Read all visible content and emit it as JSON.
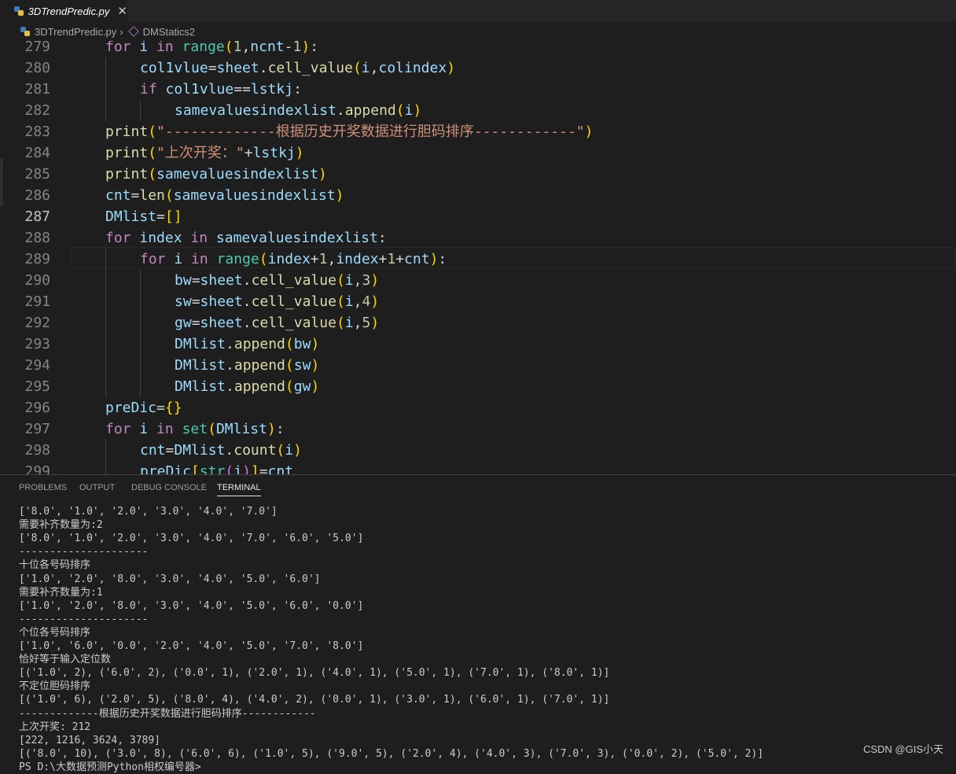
{
  "tab": {
    "title": "3DTrendPredic.py",
    "close": "✕"
  },
  "breadcrumb": {
    "file": "3DTrendPredic.py",
    "sep": "›",
    "symbol": "DMStatics2"
  },
  "editor": {
    "lines": [
      {
        "n": "279",
        "t": [
          [
            "kw",
            "for"
          ],
          [
            "op",
            " "
          ],
          [
            "var",
            "i"
          ],
          [
            "op",
            " "
          ],
          [
            "kw",
            "in"
          ],
          [
            "op",
            " "
          ],
          [
            "bi",
            "range"
          ],
          [
            "br1",
            "("
          ],
          [
            "num",
            "1"
          ],
          [
            "op",
            ","
          ],
          [
            "var",
            "ncnt"
          ],
          [
            "op",
            "-"
          ],
          [
            "num",
            "1"
          ],
          [
            "br1",
            ")"
          ],
          [
            "op",
            ":"
          ]
        ]
      },
      {
        "n": "280",
        "t": [
          [
            "var",
            "col1vlue"
          ],
          [
            "op",
            "="
          ],
          [
            "var",
            "sheet"
          ],
          [
            "op",
            "."
          ],
          [
            "fn",
            "cell_value"
          ],
          [
            "br1",
            "("
          ],
          [
            "var",
            "i"
          ],
          [
            "op",
            ","
          ],
          [
            "var",
            "colindex"
          ],
          [
            "br1",
            ")"
          ]
        ]
      },
      {
        "n": "281",
        "t": [
          [
            "kw",
            "if"
          ],
          [
            "op",
            " "
          ],
          [
            "var",
            "col1vlue"
          ],
          [
            "op",
            "=="
          ],
          [
            "var",
            "lstkj"
          ],
          [
            "op",
            ":"
          ]
        ]
      },
      {
        "n": "282",
        "t": [
          [
            "var",
            "samevaluesindexlist"
          ],
          [
            "op",
            "."
          ],
          [
            "fn",
            "append"
          ],
          [
            "br1",
            "("
          ],
          [
            "var",
            "i"
          ],
          [
            "br1",
            ")"
          ]
        ]
      },
      {
        "n": "283",
        "t": [
          [
            "fn",
            "print"
          ],
          [
            "br1",
            "("
          ],
          [
            "str",
            "\"-------------根据历史开奖数据进行胆码排序------------\""
          ],
          [
            "br1",
            ")"
          ]
        ]
      },
      {
        "n": "284",
        "t": [
          [
            "fn",
            "print"
          ],
          [
            "br1",
            "("
          ],
          [
            "str",
            "\"上次开奖：\""
          ],
          [
            "op",
            "+"
          ],
          [
            "var",
            "lstkj"
          ],
          [
            "br1",
            ")"
          ]
        ]
      },
      {
        "n": "285",
        "t": [
          [
            "fn",
            "print"
          ],
          [
            "br1",
            "("
          ],
          [
            "var",
            "samevaluesindexlist"
          ],
          [
            "br1",
            ")"
          ]
        ]
      },
      {
        "n": "286",
        "t": [
          [
            "var",
            "cnt"
          ],
          [
            "op",
            "="
          ],
          [
            "fn",
            "len"
          ],
          [
            "br1",
            "("
          ],
          [
            "var",
            "samevaluesindexlist"
          ],
          [
            "br1",
            ")"
          ]
        ]
      },
      {
        "n": "287",
        "t": [
          [
            "var",
            "DMlist"
          ],
          [
            "op",
            "="
          ],
          [
            "br1",
            "[]"
          ]
        ]
      },
      {
        "n": "288",
        "t": [
          [
            "kw",
            "for"
          ],
          [
            "op",
            " "
          ],
          [
            "var",
            "index"
          ],
          [
            "op",
            " "
          ],
          [
            "kw",
            "in"
          ],
          [
            "op",
            " "
          ],
          [
            "var",
            "samevaluesindexlist"
          ],
          [
            "op",
            ":"
          ]
        ]
      },
      {
        "n": "289",
        "t": [
          [
            "kw",
            "for"
          ],
          [
            "op",
            " "
          ],
          [
            "var",
            "i"
          ],
          [
            "op",
            " "
          ],
          [
            "kw",
            "in"
          ],
          [
            "op",
            " "
          ],
          [
            "bi",
            "range"
          ],
          [
            "br1",
            "("
          ],
          [
            "var",
            "index"
          ],
          [
            "op",
            "+"
          ],
          [
            "num",
            "1"
          ],
          [
            "op",
            ","
          ],
          [
            "var",
            "index"
          ],
          [
            "op",
            "+"
          ],
          [
            "num",
            "1"
          ],
          [
            "op",
            "+"
          ],
          [
            "var",
            "cnt"
          ],
          [
            "br1",
            ")"
          ],
          [
            "op",
            ":"
          ]
        ]
      },
      {
        "n": "290",
        "t": [
          [
            "var",
            "bw"
          ],
          [
            "op",
            "="
          ],
          [
            "var",
            "sheet"
          ],
          [
            "op",
            "."
          ],
          [
            "fn",
            "cell_value"
          ],
          [
            "br1",
            "("
          ],
          [
            "var",
            "i"
          ],
          [
            "op",
            ","
          ],
          [
            "num",
            "3"
          ],
          [
            "br1",
            ")"
          ]
        ]
      },
      {
        "n": "291",
        "t": [
          [
            "var",
            "sw"
          ],
          [
            "op",
            "="
          ],
          [
            "var",
            "sheet"
          ],
          [
            "op",
            "."
          ],
          [
            "fn",
            "cell_value"
          ],
          [
            "br1",
            "("
          ],
          [
            "var",
            "i"
          ],
          [
            "op",
            ","
          ],
          [
            "num",
            "4"
          ],
          [
            "br1",
            ")"
          ]
        ]
      },
      {
        "n": "292",
        "t": [
          [
            "var",
            "gw"
          ],
          [
            "op",
            "="
          ],
          [
            "var",
            "sheet"
          ],
          [
            "op",
            "."
          ],
          [
            "fn",
            "cell_value"
          ],
          [
            "br1",
            "("
          ],
          [
            "var",
            "i"
          ],
          [
            "op",
            ","
          ],
          [
            "num",
            "5"
          ],
          [
            "br1",
            ")"
          ]
        ]
      },
      {
        "n": "293",
        "t": [
          [
            "var",
            "DMlist"
          ],
          [
            "op",
            "."
          ],
          [
            "fn",
            "append"
          ],
          [
            "br1",
            "("
          ],
          [
            "var",
            "bw"
          ],
          [
            "br1",
            ")"
          ]
        ]
      },
      {
        "n": "294",
        "t": [
          [
            "var",
            "DMlist"
          ],
          [
            "op",
            "."
          ],
          [
            "fn",
            "append"
          ],
          [
            "br1",
            "("
          ],
          [
            "var",
            "sw"
          ],
          [
            "br1",
            ")"
          ]
        ]
      },
      {
        "n": "295",
        "t": [
          [
            "var",
            "DMlist"
          ],
          [
            "op",
            "."
          ],
          [
            "fn",
            "append"
          ],
          [
            "br1",
            "("
          ],
          [
            "var",
            "gw"
          ],
          [
            "br1",
            ")"
          ]
        ]
      },
      {
        "n": "296",
        "t": [
          [
            "var",
            "preDic"
          ],
          [
            "op",
            "="
          ],
          [
            "br1",
            "{}"
          ]
        ]
      },
      {
        "n": "297",
        "t": [
          [
            "kw",
            "for"
          ],
          [
            "op",
            " "
          ],
          [
            "var",
            "i"
          ],
          [
            "op",
            " "
          ],
          [
            "kw",
            "in"
          ],
          [
            "op",
            " "
          ],
          [
            "bi",
            "set"
          ],
          [
            "br1",
            "("
          ],
          [
            "var",
            "DMlist"
          ],
          [
            "br1",
            ")"
          ],
          [
            "op",
            ":"
          ]
        ]
      },
      {
        "n": "298",
        "t": [
          [
            "var",
            "cnt"
          ],
          [
            "op",
            "="
          ],
          [
            "var",
            "DMlist"
          ],
          [
            "op",
            "."
          ],
          [
            "fn",
            "count"
          ],
          [
            "br1",
            "("
          ],
          [
            "var",
            "i"
          ],
          [
            "br1",
            ")"
          ]
        ]
      },
      {
        "n": "299",
        "t": [
          [
            "var",
            "preDic"
          ],
          [
            "br1",
            "["
          ],
          [
            "bi",
            "str"
          ],
          [
            "br2",
            "("
          ],
          [
            "var",
            "i"
          ],
          [
            "br2",
            ")"
          ],
          [
            "br1",
            "]"
          ],
          [
            "op",
            "="
          ],
          [
            "var",
            "cnt"
          ]
        ]
      }
    ],
    "indents": [
      1,
      2,
      2,
      3,
      1,
      1,
      1,
      1,
      1,
      1,
      2,
      3,
      3,
      3,
      3,
      3,
      3,
      1,
      1,
      2,
      2
    ],
    "current_line": "287"
  },
  "panel": {
    "tabs": [
      "PROBLEMS",
      "OUTPUT",
      "DEBUG CONSOLE",
      "TERMINAL"
    ],
    "active_tab": "TERMINAL",
    "terminal": [
      "['8.0', '1.0', '2.0', '3.0', '4.0', '7.0']",
      "需要补齐数量为:2",
      "['8.0', '1.0', '2.0', '3.0', '4.0', '7.0', '6.0', '5.0']",
      "---------------------",
      "十位各号码排序",
      "['1.0', '2.0', '8.0', '3.0', '4.0', '5.0', '6.0']",
      "需要补齐数量为:1",
      "['1.0', '2.0', '8.0', '3.0', '4.0', '5.0', '6.0', '0.0']",
      "---------------------",
      "个位各号码排序",
      "['1.0', '6.0', '0.0', '2.0', '4.0', '5.0', '7.0', '8.0']",
      "恰好等于输入定位数",
      "[('1.0', 2), ('6.0', 2), ('0.0', 1), ('2.0', 1), ('4.0', 1), ('5.0', 1), ('7.0', 1), ('8.0', 1)]",
      "不定位胆码排序",
      "[('1.0', 6), ('2.0', 5), ('8.0', 4), ('4.0', 2), ('0.0', 1), ('3.0', 1), ('6.0', 1), ('7.0', 1)]",
      "-------------根据历史开奖数据进行胆码排序------------",
      "上次开奖: 212",
      "[222, 1216, 3624, 3789]",
      "[('8.0', 10), ('3.0', 8), ('6.0', 6), ('1.0', 5), ('9.0', 5), ('2.0', 4), ('4.0', 3), ('7.0', 3), ('0.0', 2), ('5.0', 2)]",
      "PS D:\\大数据预测Python相权编号器> "
    ]
  },
  "watermark": "CSDN @GIS小天"
}
